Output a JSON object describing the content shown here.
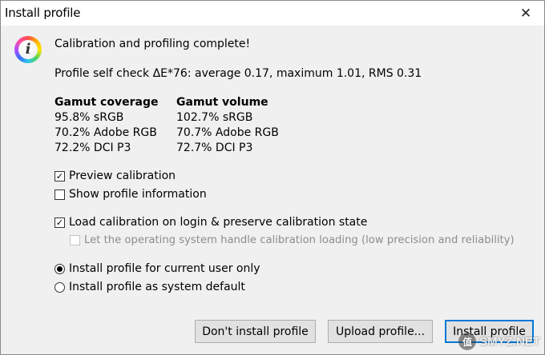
{
  "window": {
    "title": "Install profile",
    "close_glyph": "✕"
  },
  "message": {
    "icon": "info-icon",
    "headline": "Calibration and profiling complete!",
    "self_check": "Profile self check ΔE*76: average 0.17, maximum 1.01, RMS 0.31"
  },
  "gamut": {
    "coverage": {
      "heading": "Gamut coverage",
      "items": [
        "95.8% sRGB",
        "70.2% Adobe RGB",
        "72.2% DCI P3"
      ]
    },
    "volume": {
      "heading": "Gamut volume",
      "items": [
        "102.7% sRGB",
        "70.7% Adobe RGB",
        "72.7% DCI P3"
      ]
    }
  },
  "options": {
    "preview_calibration": {
      "label": "Preview calibration",
      "checked": true
    },
    "show_profile_info": {
      "label": "Show profile information",
      "checked": false
    },
    "load_calibration": {
      "label": "Load calibration on login & preserve calibration state",
      "checked": true
    },
    "os_handle_calibration": {
      "label": "Let the operating system handle calibration loading (low precision and reliability)",
      "checked": false,
      "disabled": true
    }
  },
  "install_scope": {
    "current_user": {
      "label": "Install profile for current user only",
      "selected": true
    },
    "system_default": {
      "label": "Install profile as system default",
      "selected": false
    }
  },
  "buttons": {
    "dont_install": "Don't install profile",
    "upload": "Upload profile...",
    "install": "Install profile"
  },
  "watermark": {
    "text": "SMYZ.NET",
    "badge": "值"
  }
}
